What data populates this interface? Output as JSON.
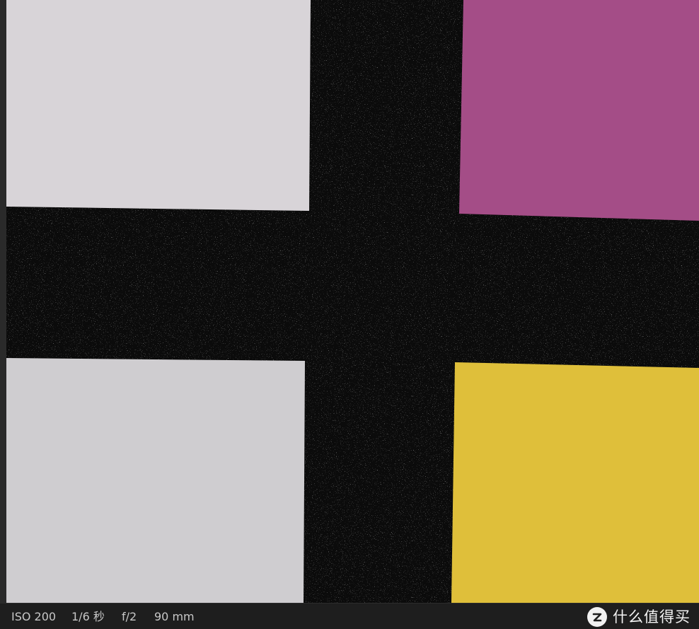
{
  "exif": {
    "iso": "ISO 200",
    "shutter": "1/6 秒",
    "aperture": "f/2",
    "focal_length": "90 mm"
  },
  "watermark": {
    "text": "什么值得买",
    "icon": "zhi-logo-icon"
  },
  "patches": {
    "top_left": "#d8d4d8",
    "top_right": "#a44d87",
    "bottom_left": "#cfcdd0",
    "bottom_right": "#dfbf3a",
    "background": "#0b0b0b"
  }
}
